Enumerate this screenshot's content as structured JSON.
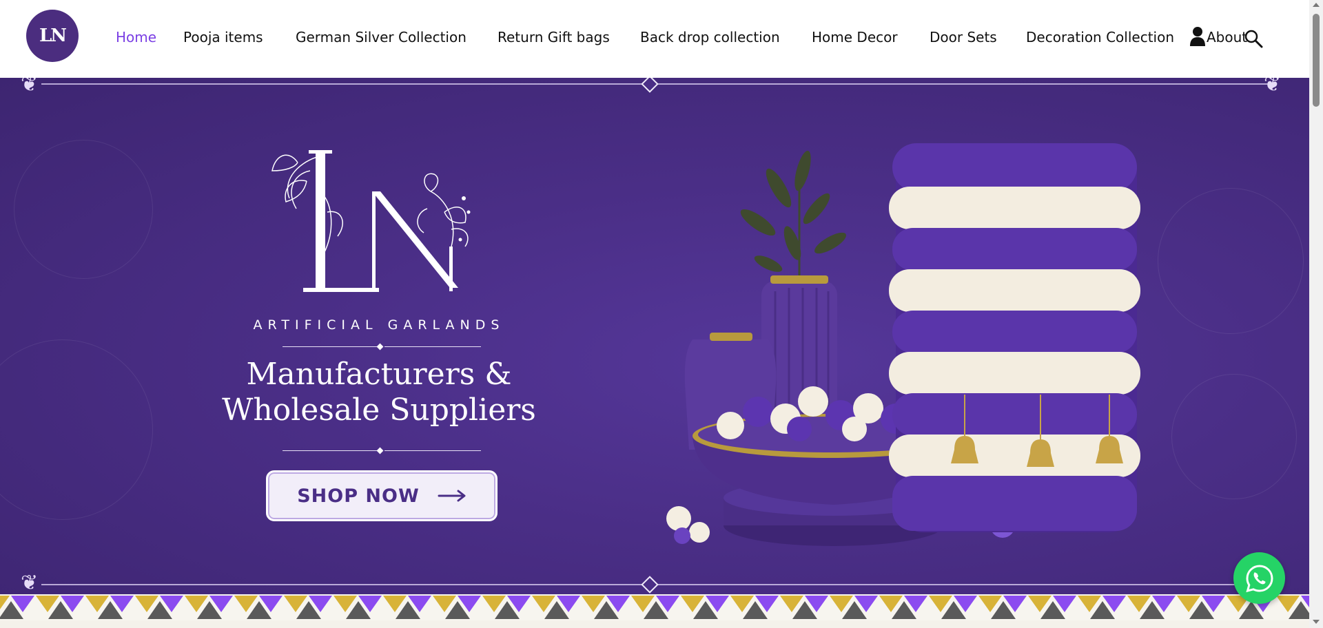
{
  "header": {
    "logo_icon": "ln-monogram-logo",
    "logo_text": "LN",
    "nav": [
      {
        "label": "Home",
        "active": true
      },
      {
        "label": "Pooja items",
        "active": false
      },
      {
        "label": "German Silver Collection",
        "active": false
      },
      {
        "label": "Return Gift bags",
        "active": false
      },
      {
        "label": "Back drop collection",
        "active": false
      },
      {
        "label": "Home Decor",
        "active": false
      },
      {
        "label": "Door Sets",
        "active": false
      },
      {
        "label": "Decoration Collection",
        "active": false
      }
    ],
    "user_icon": "user-icon",
    "about_label": "About",
    "search_icon": "search-icon"
  },
  "hero": {
    "brand_title": "ARTIFICIAL GARLANDS",
    "tagline_line1": "Manufacturers &",
    "tagline_line2": "Wholesale Suppliers",
    "cta_label": "SHOP NOW",
    "cta_icon": "arrow-right-icon"
  },
  "floating": {
    "whatsapp_icon": "whatsapp-icon"
  },
  "colors": {
    "accent": "#7b3fe4",
    "hero_bg": "#4a2e86",
    "whatsapp": "#25d366",
    "pattern_yellow": "#d8b338",
    "pattern_purple": "#8b4bf0",
    "pattern_gray": "#5a5a5a"
  }
}
